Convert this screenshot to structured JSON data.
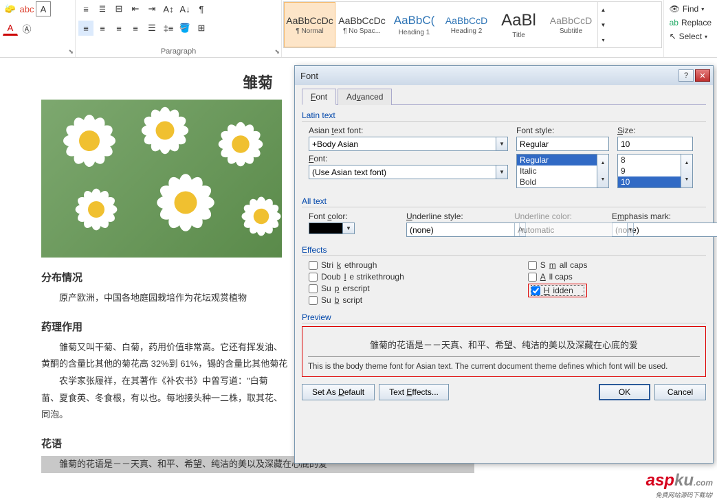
{
  "ribbon": {
    "paragraph_label": "Paragraph",
    "styles": [
      {
        "preview": "AaBbCcDc",
        "name": "¶ Normal",
        "selected": true
      },
      {
        "preview": "AaBbCcDc",
        "name": "¶ No Spac..."
      },
      {
        "preview": "AaBbC(",
        "name": "Heading 1",
        "color": "#2e74b5",
        "size": "17px"
      },
      {
        "preview": "AaBbCcD",
        "name": "Heading 2",
        "color": "#2e74b5",
        "size": "14px"
      },
      {
        "preview": "AaBl",
        "name": "Title",
        "size": "24px"
      },
      {
        "preview": "AaBbCcD",
        "name": "Subtitle",
        "color": "#888"
      }
    ],
    "edit": {
      "find": "Find",
      "replace": "Replace",
      "select": "Select"
    }
  },
  "document": {
    "title": "雏菊",
    "h2_dist": "分布情况",
    "p_dist": "原产欧洲，中国各地庭园栽培作为花坛观赏植物",
    "h2_pharm": "药理作用",
    "p_pharm1": "雏菊又叫干菊、白菊，药用价值非常高。它还有挥发油、",
    "p_pharm2": "黄酮的含量比其他的菊花高 32%到 61%，锡的含量比其他菊花",
    "p_pharm3": "农学家张履祥，在其著作《补农书》中曾写道：\"白菊",
    "p_pharm4": "苗、夏食英、冬食根，有以也。每地接头种一二株，取其花、",
    "p_pharm5": "同泡。",
    "h2_lang": "花语",
    "p_lang": "雏菊的花语是－－天真、和平、希望、纯洁的美以及深藏在心底的爱"
  },
  "dialog": {
    "title": "Font",
    "tabs": {
      "font": "Font",
      "advanced": "Advanced"
    },
    "latin": {
      "legend": "Latin text",
      "asian_label": "Asian text font:",
      "asian_value": "+Body Asian",
      "font_label": "Font:",
      "font_value": "(Use Asian text font)",
      "style_label": "Font style:",
      "style_value": "Regular",
      "style_opts": [
        "Regular",
        "Italic",
        "Bold"
      ],
      "size_label": "Size:",
      "size_value": "10",
      "size_opts": [
        "8",
        "9",
        "10"
      ]
    },
    "alltext": {
      "legend": "All text",
      "color_label": "Font color:",
      "uline_label": "Underline style:",
      "uline_value": "(none)",
      "ucolor_label": "Underline color:",
      "ucolor_value": "Automatic",
      "emph_label": "Emphasis mark:",
      "emph_value": "(none)"
    },
    "effects": {
      "legend": "Effects",
      "strike": "Strikethrough",
      "dstrike": "Double strikethrough",
      "super": "Superscript",
      "sub": "Subscript",
      "scaps": "Small caps",
      "acaps": "All caps",
      "hidden": "Hidden"
    },
    "preview": {
      "legend": "Preview",
      "sample": "雏菊的花语是－－天真、和平、希望、纯洁的美以及深藏在心底的爱",
      "desc": "This is the body theme font for Asian text. The current document theme defines which font will be used."
    },
    "buttons": {
      "default": "Set As Default",
      "texteff": "Text Effects...",
      "ok": "OK",
      "cancel": "Cancel"
    }
  },
  "watermark": {
    "brand_a": "asp",
    "brand_b": "ku",
    "tld": ".com",
    "sub": "免费网站源码下载站!"
  }
}
